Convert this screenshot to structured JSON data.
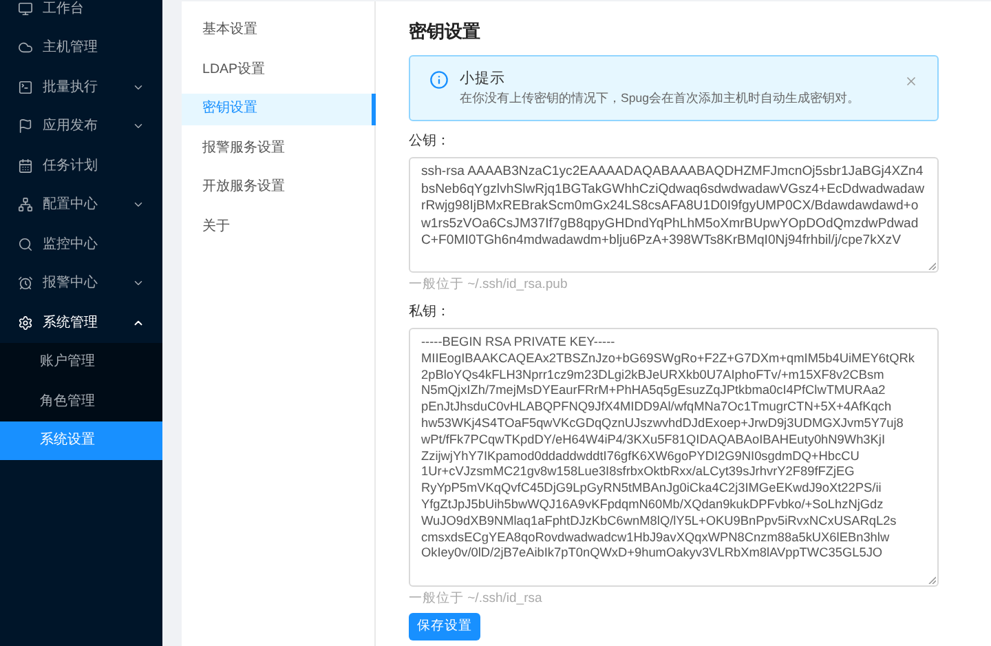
{
  "sidebar": {
    "items": [
      {
        "label": "工作台",
        "kind": "item",
        "selected": false
      },
      {
        "label": "主机管理",
        "kind": "item",
        "selected": false
      },
      {
        "label": "批量执行",
        "kind": "group",
        "expanded": false
      },
      {
        "label": "应用发布",
        "kind": "group",
        "expanded": false
      },
      {
        "label": "任务计划",
        "kind": "item",
        "selected": false
      },
      {
        "label": "配置中心",
        "kind": "group",
        "expanded": false
      },
      {
        "label": "监控中心",
        "kind": "item",
        "selected": false
      },
      {
        "label": "报警中心",
        "kind": "group",
        "expanded": false
      },
      {
        "label": "系统管理",
        "kind": "group",
        "expanded": true,
        "children": [
          {
            "label": "账户管理",
            "selected": false
          },
          {
            "label": "角色管理",
            "selected": false
          },
          {
            "label": "系统设置",
            "selected": true
          }
        ]
      }
    ]
  },
  "settings_menu": [
    {
      "label": "基本设置",
      "selected": false
    },
    {
      "label": "LDAP设置",
      "selected": false
    },
    {
      "label": "密钥设置",
      "selected": true
    },
    {
      "label": "报警服务设置",
      "selected": false
    },
    {
      "label": "开放服务设置",
      "selected": false
    },
    {
      "label": "关于",
      "selected": false
    }
  ],
  "panel": {
    "title": "密钥设置",
    "alert": {
      "title": "小提示",
      "text": "在你没有上传密钥的情况下，Spug会在首次添加主机时自动生成密钥对。"
    },
    "fields": [
      {
        "label": "公钥：",
        "value": "ssh-rsa AAAAB3NzaC1yc2EAAAADAQABAAABAQDHZMFJmcnOj5sbr1JaBGj4XZn4bsNeb6qYgzlvhSlwRjq1BGTakGWhhCziQdwaq6sdwdwadawVGsz4+EcDdwadwadawrRwjg98IjBMxREBrakScm0mGx24LS8csAFA8U1D0I9fgyUMP0CX/Bdawdawdawd+ow1rs5zVOa6CsJM37If7gB8qpyGHDndYqPhLhM5oXmrBUpwYOpDOdQmzdwPdwadC+F0MI0TGh6n4mdwadawdm+blju6PzA+398WTs8KrBMqI0Nj94frhbil/j/cpe7kXzV",
        "hint": "一般位于 ~/.ssh/id_rsa.pub"
      },
      {
        "label": "私钥：",
        "value": "-----BEGIN RSA PRIVATE KEY-----\nMIIEogIBAAKCAQEAx2TBSZnJzo+bG69SWgRo+F2Z+G7DXm+qmIM5b4UiMEY6tQRk\n2pBloYQs4kFLH3Nprr1cz9m23DLgi2kBJeURXkb0U7AIphoFTv/+m15XF8v2CBsm\nN5mQjxIZh/7mejMsDYEaurFRrM+PhHA5q5gEsuzZqJPtkbma0cI4PfClwTMURAa2\npEnJtJhsduC0vHLABQPFNQ9JfX4MIDD9Al/wfqMNa7Oc1TmugrCTN+5X+4AfKqch\nhw53WKj4S4TOaF5qwVKcGDqQznUJszwvhdDJdExoep+JrwD9j3UDMGXJvm5Y7uj8\nwPt/fFk7PCqwTKpdDY/eH64W4iP4/3KXu5F81QIDAQABAoIBAHEuty0hN9Wh3KjI\nZzijwjYhY7IKpamod0ddaddwddtI76gfK6XW6goPYDI2G9NI0sgdmDQ+HbcCU\n1Ur+cVJzsmMC21gv8w158Lue3I8sfrbxOktbRxx/aLCyt39sJrhvrY2F89fFZjEG\nRyYpP5mVKqQvfC45DjG9LpGyRN5tMBAnJg0iCka4C2j3IMGeEKwdJ9oXt22PS/ii\nYfgZtJpJ5bUih5bwWQJ16A9vKFpdqmN60Mb/XQdan9kukDPFvbko/+SoLhzNjGdz\nWuJO9dXB9NMlaq1aFphtDJzKbC6wnM8lQ/lY5L+OKU9BnPpv5iRvxNCxUSARqL2s\ncmsxdsECgYEA8qoRovdwadwadcw1HbJ9avXQqxWPN8Cnzm88a5kUX6lEBn3hlw\nOkIey0v/0lD/2jB7eAibIk7pT0nQWxD+9humOakyv3VLRbXm8lAVppTWC35GL5JO",
        "hint": "一般位于 ~/.ssh/id_rsa"
      }
    ],
    "save_button": "保存设置"
  }
}
